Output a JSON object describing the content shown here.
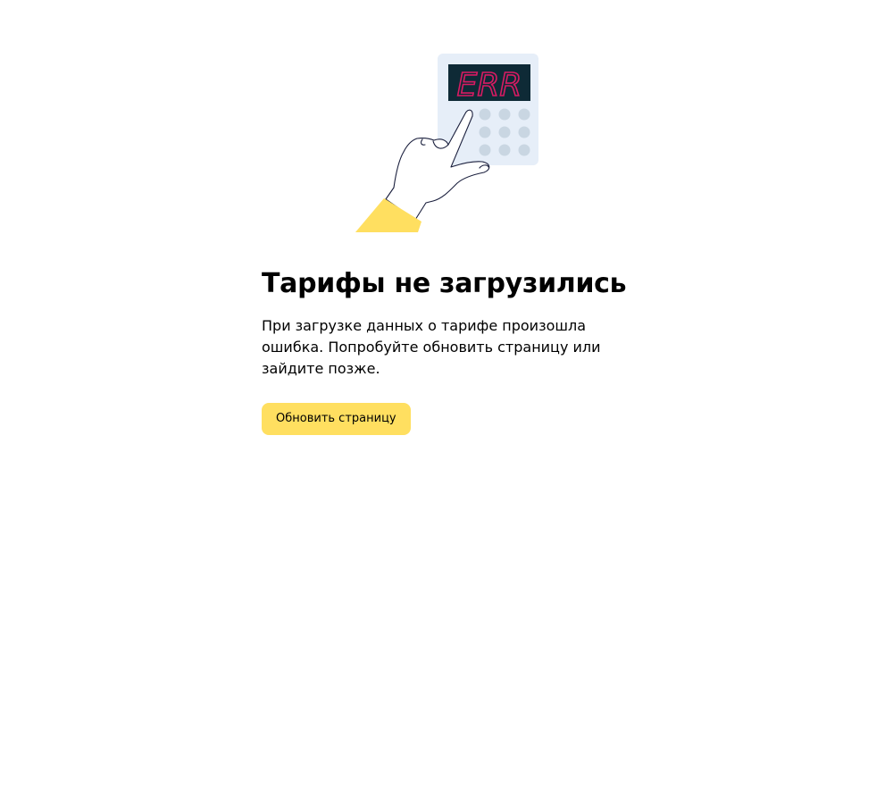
{
  "error": {
    "title": "Тарифы не загрузились",
    "description": "При загрузке данных о тарифе произошла ошибка. Попробуйте обновить страницу или зайдите позже.",
    "refresh_button_label": "Обновить страницу"
  },
  "illustration": {
    "display_text": "ERR",
    "icon": "hand-pressing-calculator-icon"
  },
  "colors": {
    "accent": "#ffdf60",
    "display_background": "#0e2a36",
    "display_text": "#d81b63",
    "keypad_background": "#e6eef8",
    "key": "#c9d6e2"
  }
}
